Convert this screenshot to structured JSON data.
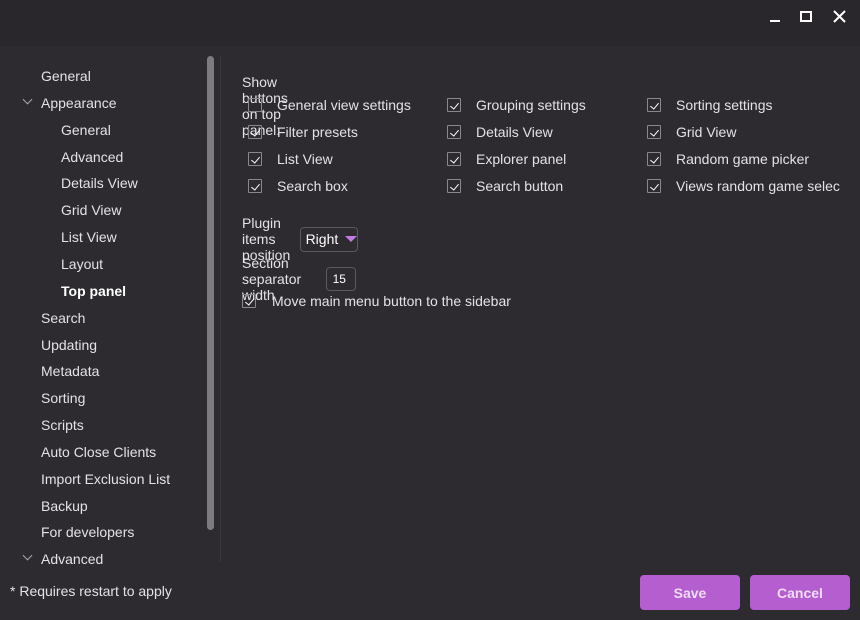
{
  "window": {
    "controls": [
      {
        "name": "minimize",
        "icon": "minimize-icon"
      },
      {
        "name": "maximize",
        "icon": "maximize-icon"
      },
      {
        "name": "close",
        "icon": "close-icon",
        "glyph": "✕"
      }
    ]
  },
  "sidebar": {
    "items": [
      {
        "label": "General",
        "level": 0
      },
      {
        "label": "Appearance",
        "level": 0,
        "expanded": true
      },
      {
        "label": "General",
        "level": 1
      },
      {
        "label": "Advanced",
        "level": 1
      },
      {
        "label": "Details View",
        "level": 1
      },
      {
        "label": "Grid View",
        "level": 1
      },
      {
        "label": "List View",
        "level": 1
      },
      {
        "label": "Layout",
        "level": 1
      },
      {
        "label": "Top panel",
        "level": 1,
        "selected": true
      },
      {
        "label": "Search",
        "level": 0
      },
      {
        "label": "Updating",
        "level": 0
      },
      {
        "label": "Metadata",
        "level": 0
      },
      {
        "label": "Sorting",
        "level": 0
      },
      {
        "label": "Scripts",
        "level": 0
      },
      {
        "label": "Auto Close Clients",
        "level": 0
      },
      {
        "label": "Import Exclusion List",
        "level": 0
      },
      {
        "label": "Backup",
        "level": 0
      },
      {
        "label": "For developers",
        "level": 0
      },
      {
        "label": "Advanced",
        "level": 0,
        "expanded": true
      }
    ]
  },
  "main": {
    "section_title": "Show buttons on top panel:",
    "checkboxes": [
      {
        "label": "General view settings",
        "checked": false
      },
      {
        "label": "Grouping settings",
        "checked": true
      },
      {
        "label": "Sorting settings",
        "checked": true
      },
      {
        "label": "Filter presets",
        "checked": true
      },
      {
        "label": "Details View",
        "checked": true
      },
      {
        "label": "Grid View",
        "checked": true
      },
      {
        "label": "List View",
        "checked": true
      },
      {
        "label": "Explorer panel",
        "checked": true
      },
      {
        "label": "Random game picker",
        "checked": true
      },
      {
        "label": "Search box",
        "checked": true
      },
      {
        "label": "Search button",
        "checked": true
      },
      {
        "label": "Views random game selec",
        "checked": true
      }
    ],
    "plugin_position": {
      "label": "Plugin items position",
      "value": "Right"
    },
    "separator_width": {
      "label": "Section separator width",
      "value": "15"
    },
    "move_menu": {
      "label": "Move main menu button to the sidebar",
      "checked": true
    }
  },
  "footer": {
    "note": "* Requires restart to apply",
    "save_label": "Save",
    "cancel_label": "Cancel"
  },
  "colors": {
    "accent": "#b45ed0",
    "background": "#2d2b30",
    "titlebar": "#29272b"
  }
}
